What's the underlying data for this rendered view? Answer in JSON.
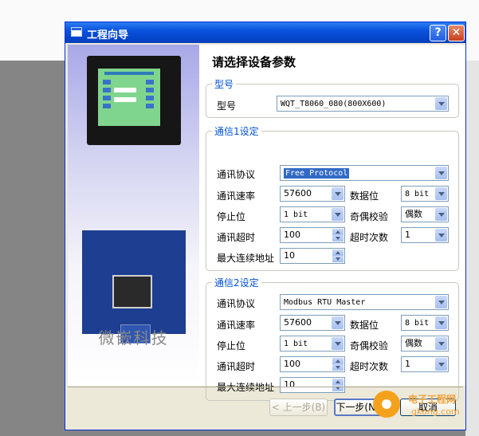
{
  "window": {
    "title": "工程向导",
    "help_glyph": "?",
    "close_glyph": "✕"
  },
  "left_panel": {
    "brand_text": "微嵌科技"
  },
  "heading": "请选择设备参数",
  "model_group": {
    "legend": "型号",
    "label": "型号",
    "value": "WQT_T8060_080(800X600)"
  },
  "comm1": {
    "legend": "通信1设定",
    "protocol_label": "通讯协议",
    "protocol_value": "Free Protocol",
    "baud_label": "通讯速率",
    "baud_value": "57600",
    "databits_label": "数据位",
    "databits_value": "8 bit",
    "stopbits_label": "停止位",
    "stopbits_value": "1 bit",
    "parity_label": "奇偶校验",
    "parity_value": "偶数",
    "timeout_label": "通讯超时",
    "timeout_value": "100",
    "retries_label": "超时次数",
    "retries_value": "1",
    "maxaddr_label": "最大连续地址",
    "maxaddr_value": "10"
  },
  "comm2": {
    "legend": "通信2设定",
    "protocol_label": "通讯协议",
    "protocol_value": "Modbus RTU Master",
    "baud_label": "通讯速率",
    "baud_value": "57600",
    "databits_label": "数据位",
    "databits_value": "8 bit",
    "stopbits_label": "停止位",
    "stopbits_value": "1 bit",
    "parity_label": "奇偶校验",
    "parity_value": "偶数",
    "timeout_label": "通讯超时",
    "timeout_value": "100",
    "retries_label": "超时次数",
    "retries_value": "1",
    "maxaddr_label": "最大连续地址",
    "maxaddr_value": "10"
  },
  "buttons": {
    "prev": "< 上一步(B)",
    "next": "下一步(N) >",
    "cancel": "取消"
  },
  "watermark": {
    "text": "电子工程网",
    "sub": "gkong.com"
  },
  "colors": {
    "titlebar": "#0a52de",
    "legend": "#0050d2",
    "selection": "#316ac5",
    "watermark": "#f2a23a"
  }
}
